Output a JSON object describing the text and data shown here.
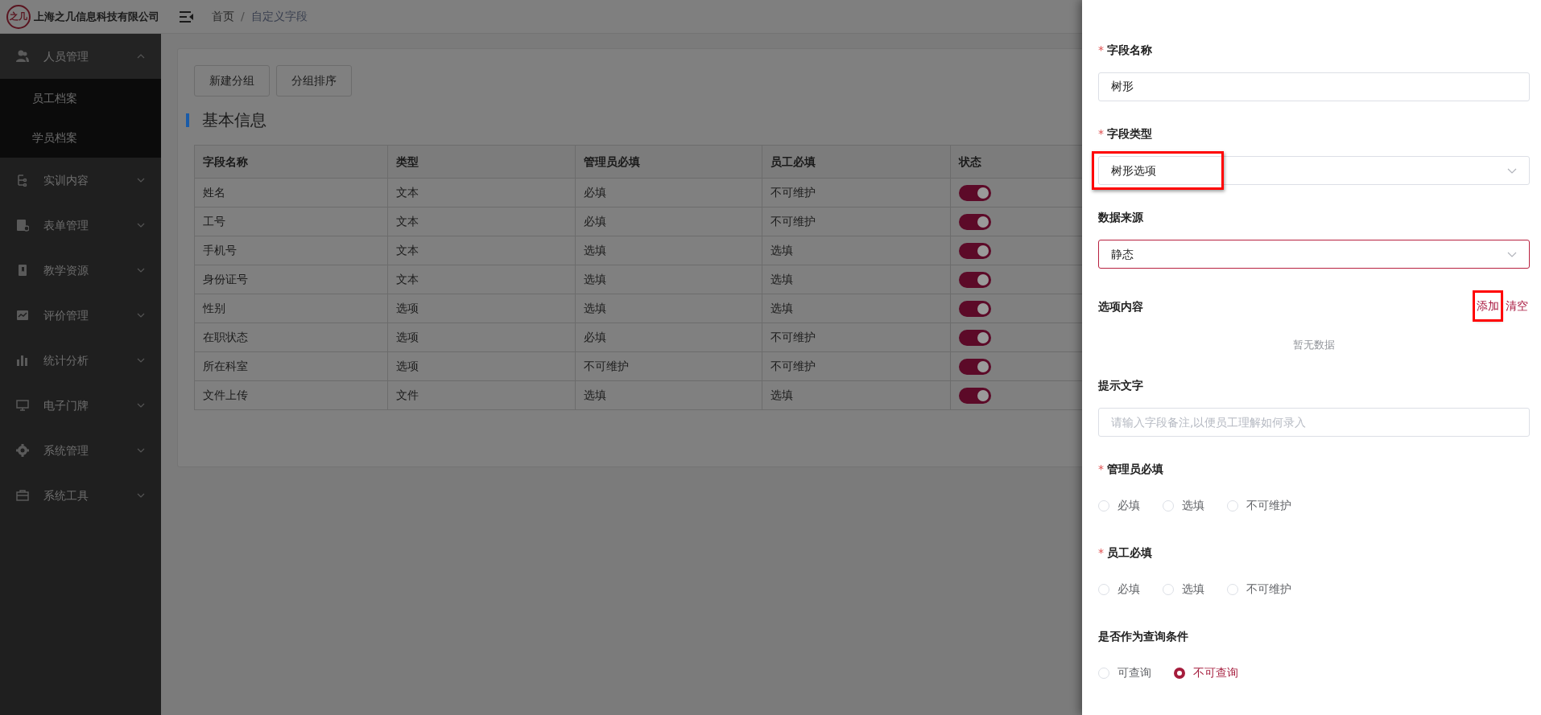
{
  "header": {
    "logo_text": "之几",
    "company": "上海之几信息科技有限公司",
    "breadcrumb": [
      "首页",
      "自定义字段"
    ],
    "separator": "/"
  },
  "sidebar": {
    "items": [
      {
        "label": "人员管理",
        "expanded": true,
        "children": [
          {
            "label": "员工档案",
            "selected": false
          },
          {
            "label": "学员档案",
            "selected": false
          }
        ]
      },
      {
        "label": "实训内容",
        "expanded": false
      },
      {
        "label": "表单管理",
        "expanded": false
      },
      {
        "label": "教学资源",
        "expanded": false
      },
      {
        "label": "评价管理",
        "expanded": false
      },
      {
        "label": "统计分析",
        "expanded": false
      },
      {
        "label": "电子门牌",
        "expanded": false
      },
      {
        "label": "系统管理",
        "expanded": false
      },
      {
        "label": "系统工具",
        "expanded": false
      }
    ]
  },
  "content": {
    "buttons": [
      "新建分组",
      "分组排序"
    ],
    "section_title": "基本信息",
    "table": {
      "columns": [
        "字段名称",
        "类型",
        "管理员必填",
        "员工必填",
        "状态"
      ],
      "rows": [
        {
          "cells": [
            "姓名",
            "文本",
            "必填",
            "不可维护"
          ],
          "on": true
        },
        {
          "cells": [
            "工号",
            "文本",
            "必填",
            "不可维护"
          ],
          "on": true
        },
        {
          "cells": [
            "手机号",
            "文本",
            "选填",
            "选填"
          ],
          "on": true
        },
        {
          "cells": [
            "身份证号",
            "文本",
            "选填",
            "选填"
          ],
          "on": true
        },
        {
          "cells": [
            "性别",
            "选项",
            "选填",
            "选填"
          ],
          "on": true
        },
        {
          "cells": [
            "在职状态",
            "选项",
            "必填",
            "不可维护"
          ],
          "on": true
        },
        {
          "cells": [
            "所在科室",
            "选项",
            "不可维护",
            "不可维护"
          ],
          "on": true
        },
        {
          "cells": [
            "文件上传",
            "文件",
            "选填",
            "选填"
          ],
          "on": true
        }
      ]
    }
  },
  "drawer": {
    "fields": [
      {
        "kind": "text",
        "label": "字段名称",
        "required_mark": "*",
        "value": "树形"
      },
      {
        "kind": "select",
        "label": "字段类型",
        "required_mark": "*",
        "value": "树形选项",
        "focused": false,
        "highlighted": true
      },
      {
        "kind": "select",
        "label": "数据来源",
        "value": "静态",
        "focused": true
      },
      {
        "kind": "options",
        "label": "选项内容",
        "actions": [
          {
            "label": "添加",
            "highlighted": true
          },
          {
            "label": "清空",
            "highlighted": false
          }
        ],
        "empty_text": "暂无数据"
      },
      {
        "kind": "text",
        "label": "提示文字",
        "placeholder": "请输入字段备注,以便员工理解如何录入"
      },
      {
        "kind": "radio",
        "label": "管理员必填",
        "required_mark": "*",
        "options": [
          {
            "label": "必填",
            "selected": false
          },
          {
            "label": "选填",
            "selected": false
          },
          {
            "label": "不可维护",
            "selected": false
          }
        ]
      },
      {
        "kind": "radio",
        "label": "员工必填",
        "required_mark": "*",
        "options": [
          {
            "label": "必填",
            "selected": false
          },
          {
            "label": "选填",
            "selected": false
          },
          {
            "label": "不可维护",
            "selected": false
          }
        ]
      },
      {
        "kind": "radio",
        "label": "是否作为查询条件",
        "options": [
          {
            "label": "可查询",
            "selected": false
          },
          {
            "label": "不可查询",
            "selected": true
          }
        ]
      }
    ]
  }
}
